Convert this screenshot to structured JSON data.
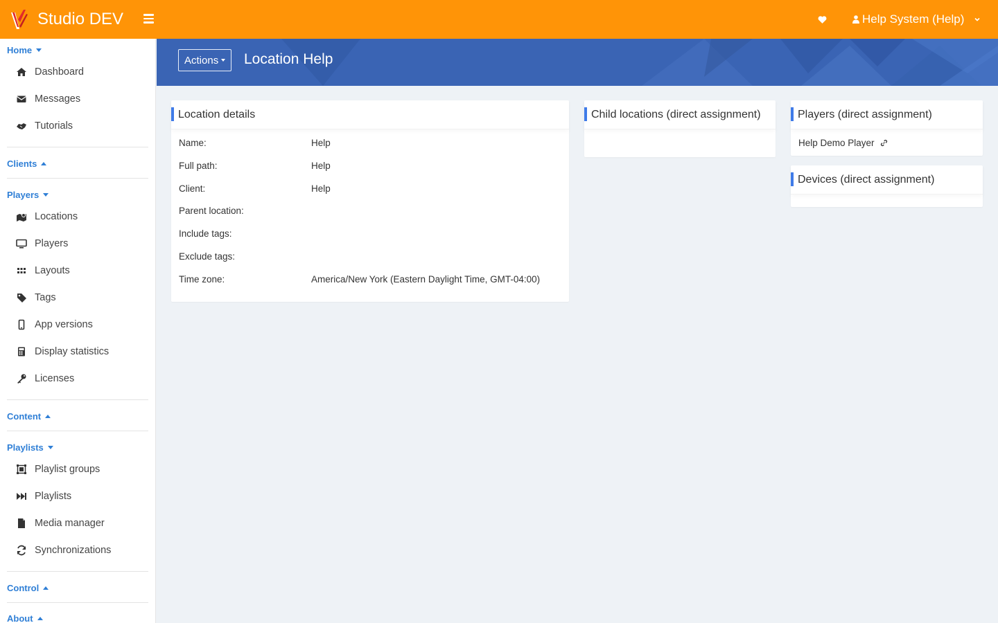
{
  "app": {
    "title": "Studio DEV"
  },
  "header": {
    "user_label": "Help System (Help)"
  },
  "sidebar": {
    "home": {
      "label": "Home",
      "items": [
        "Dashboard",
        "Messages",
        "Tutorials"
      ]
    },
    "clients": {
      "label": "Clients"
    },
    "players": {
      "label": "Players",
      "items": [
        "Locations",
        "Players",
        "Layouts",
        "Tags",
        "App versions",
        "Display statistics",
        "Licenses"
      ]
    },
    "content": {
      "label": "Content"
    },
    "playlists": {
      "label": "Playlists",
      "items": [
        "Playlist groups",
        "Playlists",
        "Media manager",
        "Synchronizations"
      ]
    },
    "control": {
      "label": "Control"
    },
    "about": {
      "label": "About"
    }
  },
  "page": {
    "actions_label": "Actions",
    "title": "Location Help"
  },
  "location_details": {
    "title": "Location details",
    "rows": [
      {
        "label": "Name:",
        "value": "Help"
      },
      {
        "label": "Full path:",
        "value": "Help"
      },
      {
        "label": "Client:",
        "value": "Help"
      },
      {
        "label": "Parent location:",
        "value": ""
      },
      {
        "label": "Include tags:",
        "value": ""
      },
      {
        "label": "Exclude tags:",
        "value": ""
      },
      {
        "label": "Time zone:",
        "value": "America/New York (Eastern Daylight Time, GMT-04:00)"
      }
    ]
  },
  "child_locations": {
    "title": "Child locations (direct assignment)"
  },
  "players_panel": {
    "title": "Players (direct assignment)",
    "player_name": "Help Demo Player"
  },
  "devices_panel": {
    "title": "Devices (direct assignment)"
  },
  "colors": {
    "topbar": "#ff9407",
    "band": "#3a64b4",
    "link": "#2f7fd6",
    "accent": "#3f7be8"
  }
}
